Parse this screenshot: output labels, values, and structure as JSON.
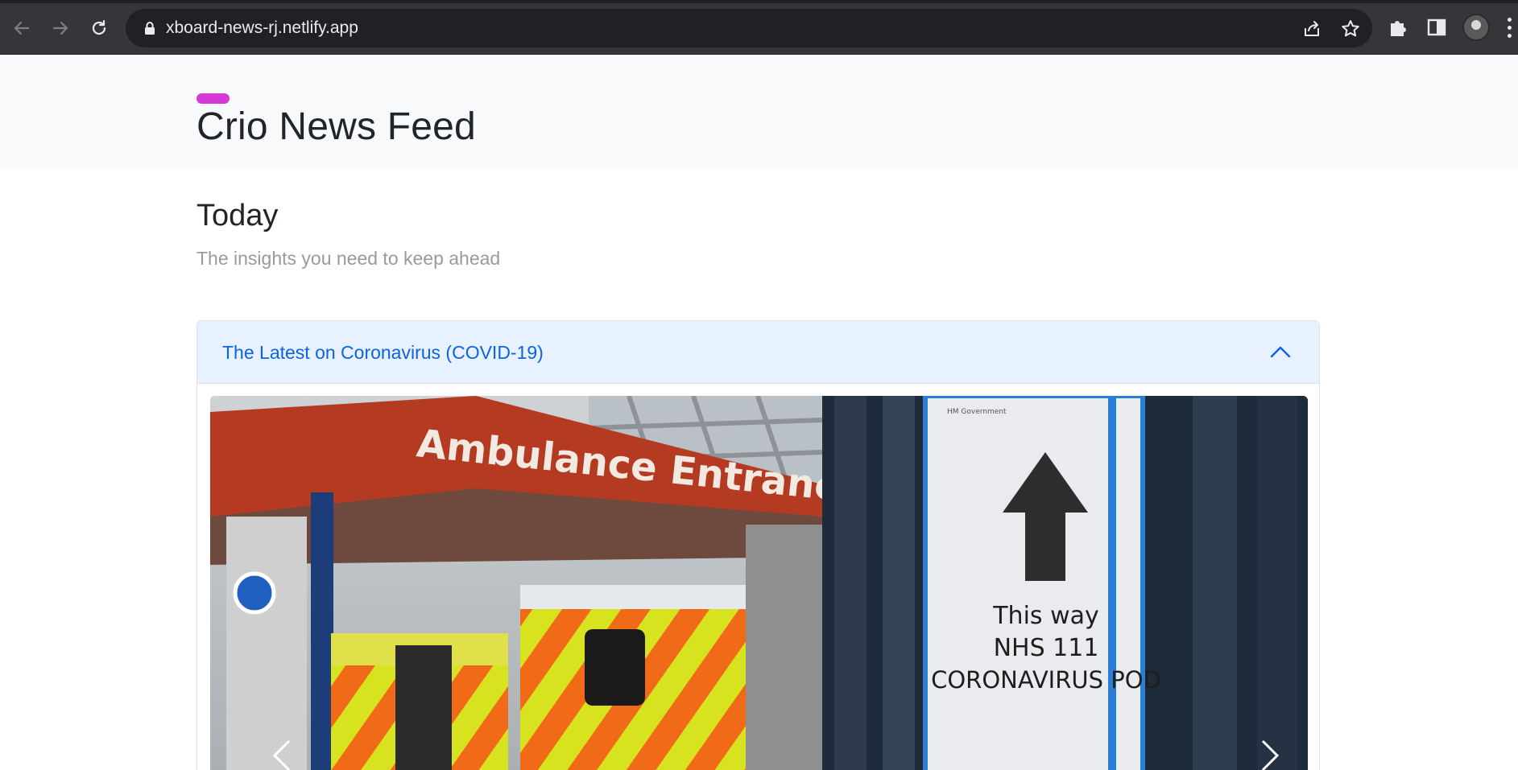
{
  "browser": {
    "url": "xboard-news-rj.netlify.app"
  },
  "site": {
    "title": "Crio News Feed",
    "brand_color": "#d63ad6"
  },
  "main": {
    "heading": "Today",
    "subheading": "The insights you need to keep ahead"
  },
  "accordion": {
    "items": [
      {
        "title": "The Latest on Coronavirus (COVID-19)",
        "expanded": true,
        "header_bg": "#e7f1ff",
        "title_color": "#0c63e4"
      }
    ]
  },
  "carousel": {
    "slide": {
      "sign_text": "Ambulance Entrance",
      "poster_lines": [
        "This way",
        "NHS 111",
        "CORONAVIRUS POD"
      ],
      "poster_small": "HM Government"
    }
  },
  "icons": {
    "back": "arrow-left-icon",
    "forward": "arrow-right-icon",
    "reload": "reload-icon",
    "lock": "lock-icon",
    "share": "share-icon",
    "bookmark": "star-icon",
    "extensions": "puzzle-icon",
    "side_panel": "side-panel-icon",
    "menu": "kebab-menu-icon",
    "collapse": "chevron-up-icon",
    "prev": "chevron-left-icon",
    "next": "chevron-right-icon"
  }
}
